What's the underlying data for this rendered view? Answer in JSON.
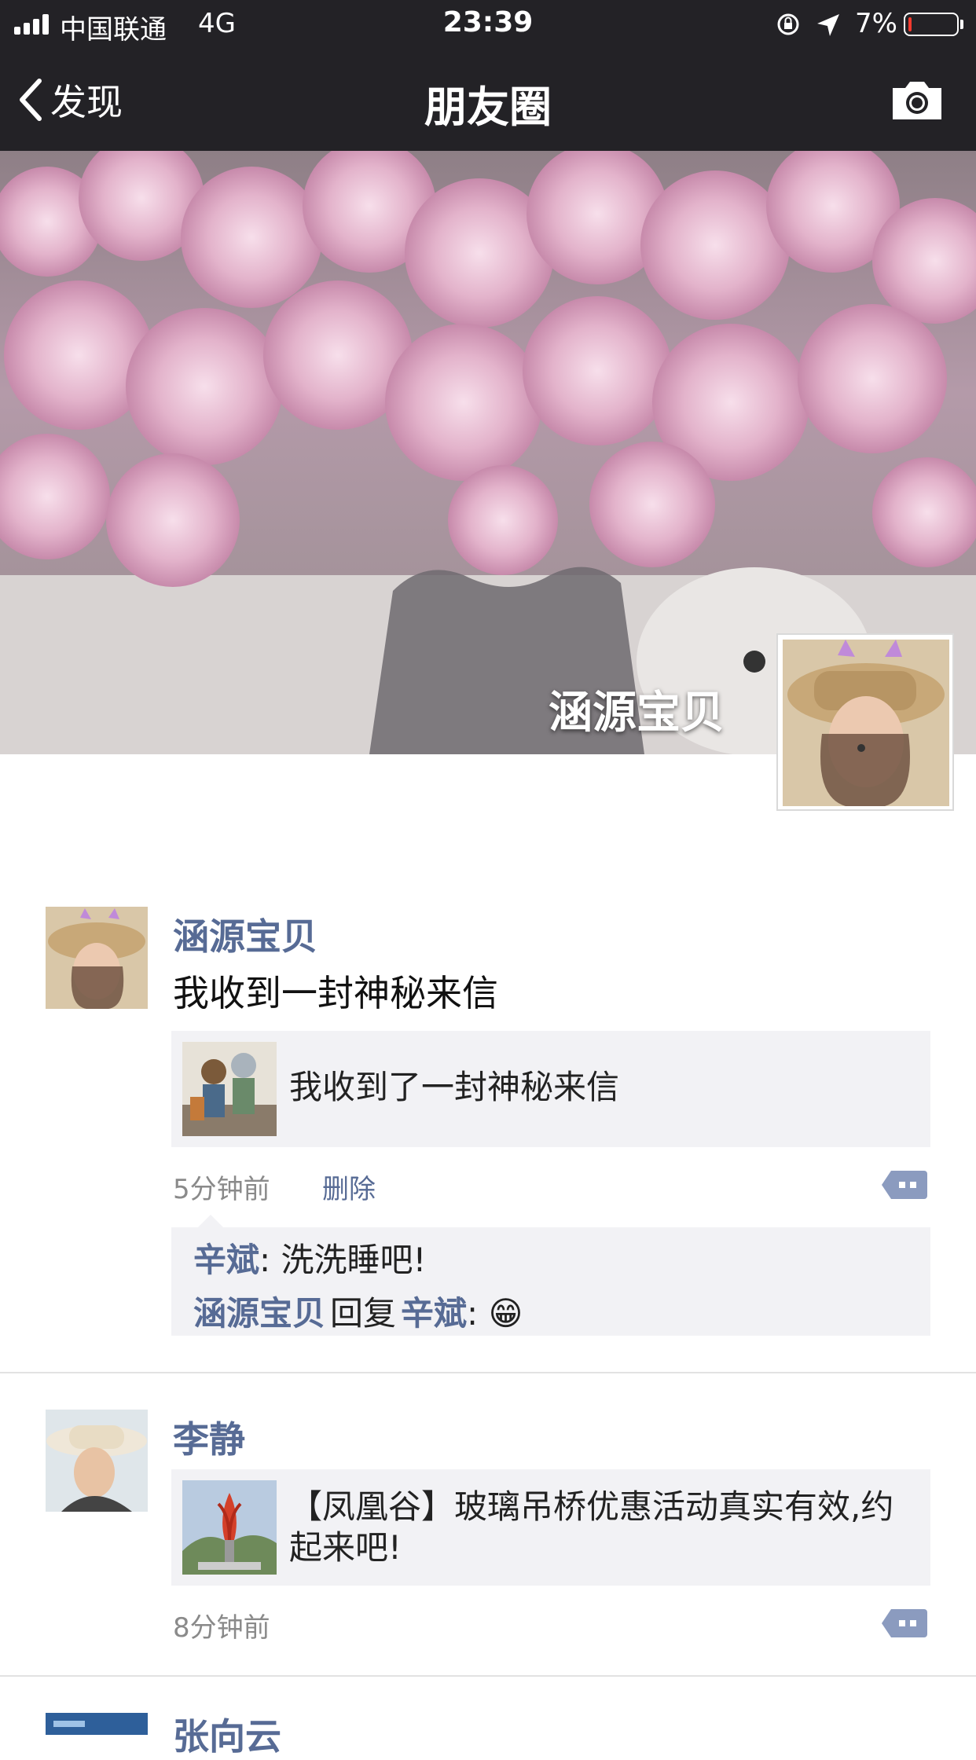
{
  "status_bar": {
    "carrier": "中国联通",
    "network": "4G",
    "time": "23:39",
    "battery_percent": "7%",
    "battery_level": 0.07,
    "icons": [
      "signal-icon",
      "orientation-lock-icon",
      "location-icon",
      "battery-icon"
    ]
  },
  "nav": {
    "back_label": "发现",
    "title": "朋友圈",
    "camera_icon": "camera-icon"
  },
  "cover": {
    "name": "涵源宝贝"
  },
  "posts": [
    {
      "name": "涵源宝贝",
      "text": "我收到一封神秘来信",
      "share_text": "我收到了一封神秘来信",
      "time": "5分钟前",
      "delete_label": "删除",
      "comments": [
        {
          "user": "辛斌",
          "sep": ": ",
          "text": "洗洗睡吧!"
        },
        {
          "user": "涵源宝贝",
          "reply_word": "回复",
          "reply_to": "辛斌",
          "sep": ": ",
          "emoji": "😁"
        }
      ]
    },
    {
      "name": "李静",
      "share_text": "【凤凰谷】玻璃吊桥优惠活动真实有效,约起来吧!",
      "time": "8分钟前"
    },
    {
      "name": "张向云"
    }
  ],
  "colors": {
    "nav_bg": "#232226",
    "link_blue": "#576b95",
    "share_bg": "#f2f2f5",
    "meta_gray": "#8a8a8a"
  }
}
